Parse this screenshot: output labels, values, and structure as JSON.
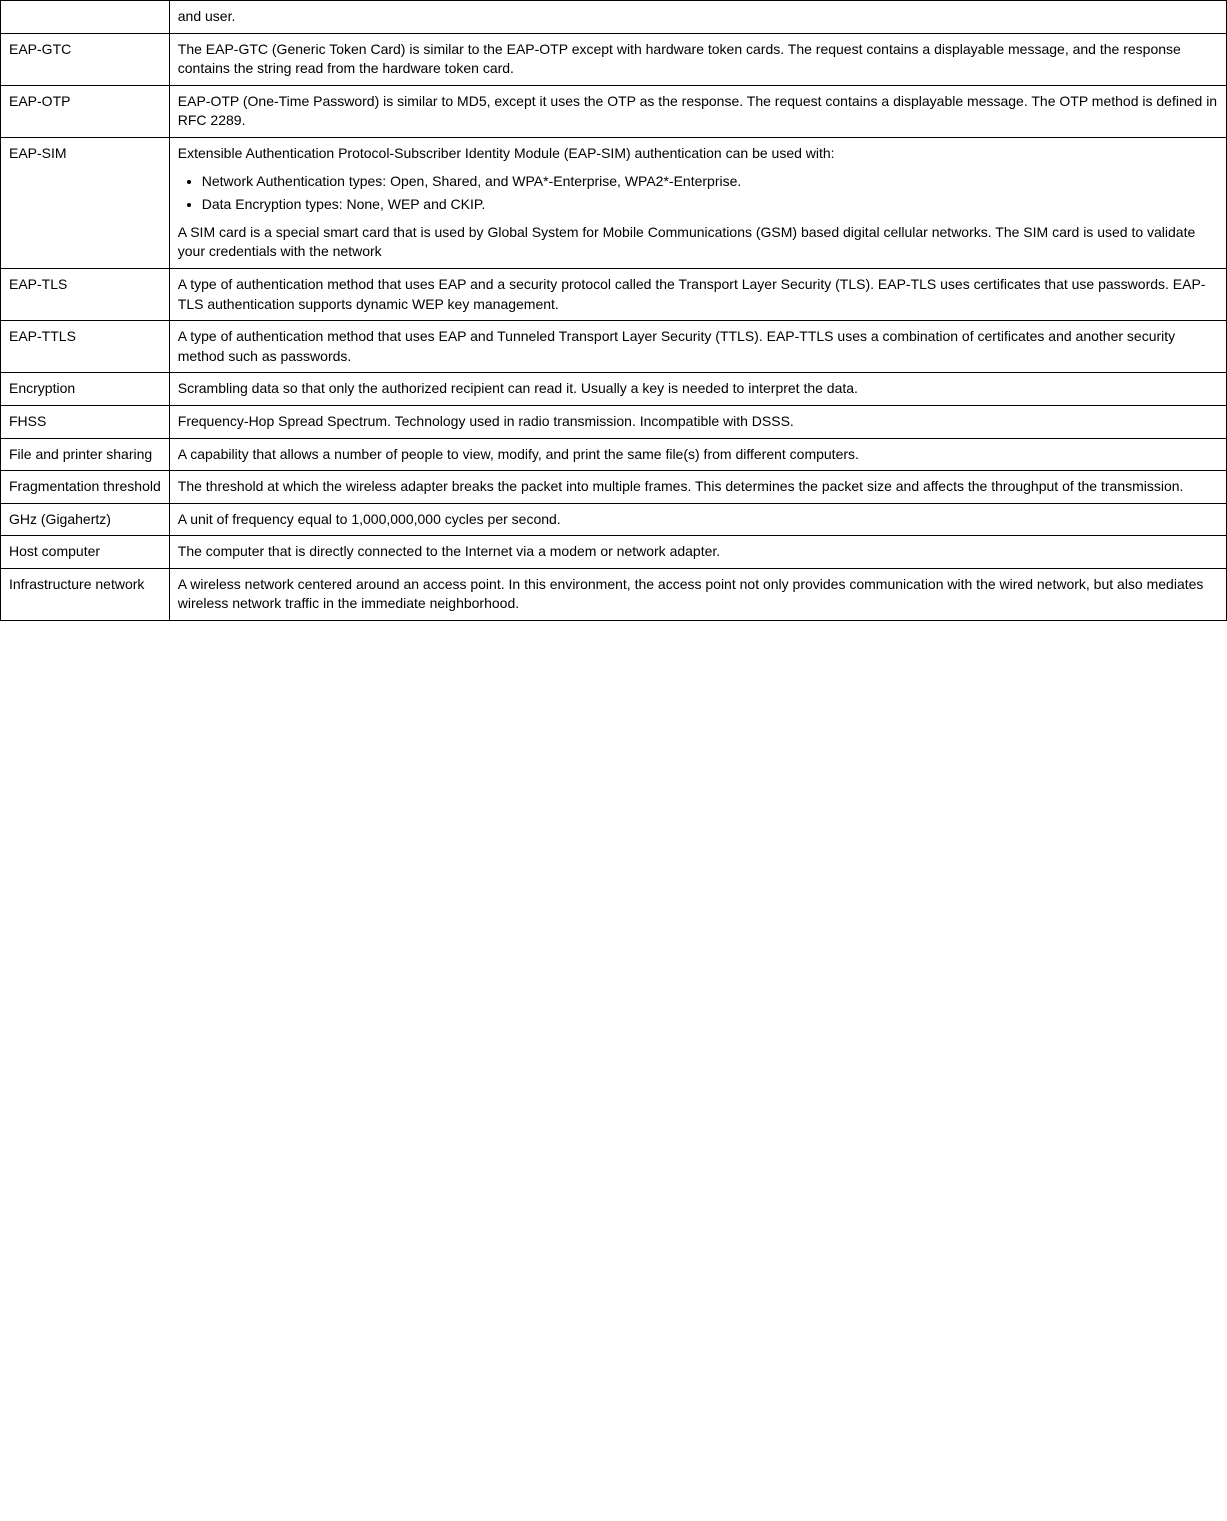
{
  "table": {
    "rows": [
      {
        "term": "",
        "definition": "and user.",
        "partialRow": true
      },
      {
        "term": "EAP-GTC",
        "definition": "The EAP-GTC (Generic Token Card) is similar to the EAP-OTP except with hardware token cards. The request contains a displayable message, and the response contains the string read from the hardware token card."
      },
      {
        "term": "EAP-OTP",
        "definition": "EAP-OTP (One-Time Password) is similar to MD5, except it uses the OTP as the response. The request contains a displayable message. The OTP method is defined in RFC 2289."
      },
      {
        "term": "EAP-SIM",
        "definition_type": "complex",
        "definition_intro": "Extensible Authentication Protocol-Subscriber Identity Module (EAP-SIM) authentication can be used with:",
        "definition_bullets": [
          "Network Authentication types: Open, Shared, and WPA*-Enterprise, WPA2*-Enterprise.",
          "Data Encryption types: None, WEP and CKIP."
        ],
        "definition_outro": "A SIM card is a special smart card that is used by Global System for Mobile Communications (GSM) based digital cellular networks. The SIM card is used to validate your credentials with the network"
      },
      {
        "term": "EAP-TLS",
        "definition": "A type of authentication method that uses EAP and a security protocol called the Transport Layer Security (TLS). EAP-TLS uses certificates that use passwords. EAP-TLS authentication supports dynamic WEP key management."
      },
      {
        "term": "EAP-TTLS",
        "definition": "A type of authentication method that uses EAP and Tunneled Transport Layer Security (TTLS). EAP-TTLS uses a combination of certificates and another security method such as passwords."
      },
      {
        "term": "Encryption",
        "definition": "Scrambling data so that only the authorized recipient can read it. Usually a key is needed to interpret the data."
      },
      {
        "term": "FHSS",
        "definition": "Frequency-Hop Spread Spectrum. Technology used in radio transmission. Incompatible with DSSS."
      },
      {
        "term": "File and printer sharing",
        "definition": "A capability that allows a number of people to view, modify, and print the same file(s) from different computers."
      },
      {
        "term": "Fragmentation threshold",
        "definition": "The threshold at which the wireless adapter breaks the packet into multiple frames. This determines the packet size and affects the throughput of the transmission."
      },
      {
        "term": "GHz (Gigahertz)",
        "definition": "A unit of frequency equal to 1,000,000,000 cycles per second."
      },
      {
        "term": "Host computer",
        "definition": "The computer that is directly connected to the Internet via a modem or network adapter."
      },
      {
        "term": "Infrastructure network",
        "definition": "A wireless network centered around an access point. In this environment, the access point not only provides communication with the wired network, but also mediates wireless network traffic in the immediate neighborhood."
      }
    ]
  }
}
